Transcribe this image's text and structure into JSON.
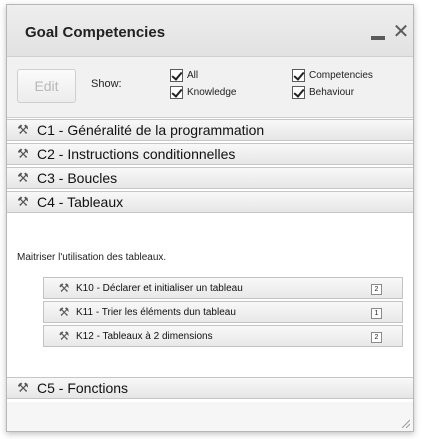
{
  "window": {
    "title": "Goal Competencies",
    "minimize_icon": "minimize-icon",
    "close_icon": "close-icon",
    "close_glyph": "✕"
  },
  "toolbar": {
    "edit_label": "Edit",
    "show_label": "Show:",
    "filters": [
      {
        "label": "All",
        "checked": true
      },
      {
        "label": "Knowledge",
        "checked": true
      },
      {
        "label": "Competencies",
        "checked": true
      },
      {
        "label": "Behaviour",
        "checked": true
      }
    ]
  },
  "competencies": [
    {
      "label": "C1 - Généralité de la programmation",
      "icon": "tools-icon"
    },
    {
      "label": "C2 - Instructions conditionnelles",
      "icon": "tools-icon"
    },
    {
      "label": "C3 - Boucles",
      "icon": "tools-icon"
    },
    {
      "label": "C4 - Tableaux",
      "icon": "tools-icon",
      "expanded": true
    }
  ],
  "expanded": {
    "description": "Maitriser l'utilisation des tableaux.",
    "items": [
      {
        "label": "K10 - Déclarer et initialiser un tableau",
        "badge": "2",
        "icon": "tools-icon"
      },
      {
        "label": "K11 - Trier les éléments dun tableau",
        "badge": "1",
        "icon": "tools-icon"
      },
      {
        "label": "K12 - Tableaux à 2 dimensions",
        "badge": "2",
        "icon": "tools-icon"
      }
    ]
  },
  "after": [
    {
      "label": "C5 - Fonctions",
      "icon": "tools-icon"
    }
  ]
}
